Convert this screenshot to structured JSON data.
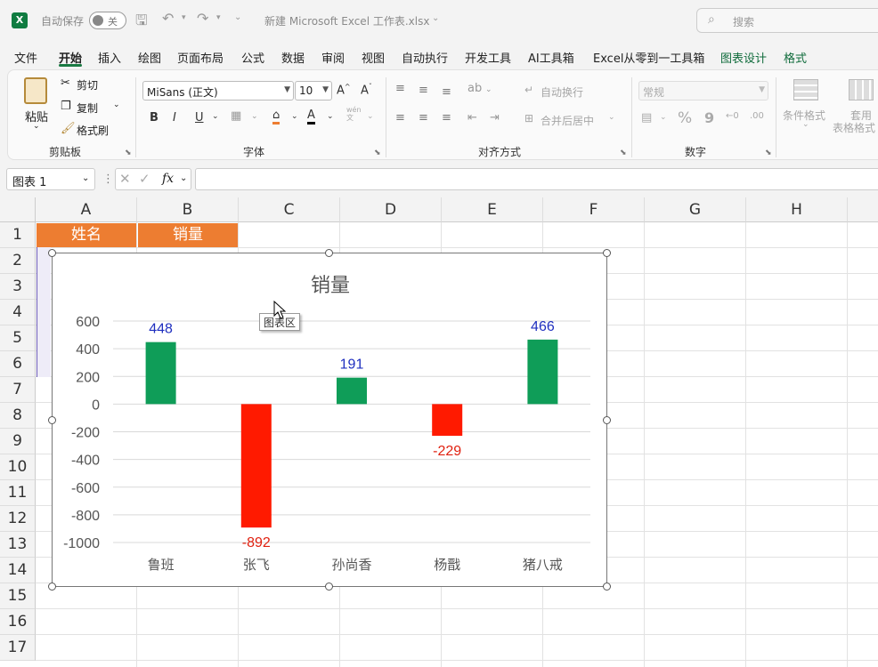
{
  "titlebar": {
    "autosave_label": "自动保存",
    "autosave_state": "关",
    "doc_title": "新建 Microsoft Excel 工作表.xlsx",
    "search_placeholder": "搜索"
  },
  "tabs": [
    "文件",
    "开始",
    "插入",
    "绘图",
    "页面布局",
    "公式",
    "数据",
    "审阅",
    "视图",
    "自动执行",
    "开发工具",
    "AI工具箱",
    "Excel从零到一工具箱",
    "图表设计",
    "格式"
  ],
  "active_tab": "开始",
  "ribbon": {
    "clipboard": {
      "paste": "粘贴",
      "cut": "剪切",
      "copy": "复制",
      "format_painter": "格式刷",
      "label": "剪贴板"
    },
    "font": {
      "name": "MiSans (正文)",
      "size": "10",
      "bold": "B",
      "italic": "I",
      "underline": "U",
      "label": "字体",
      "wen": "wén",
      "wen2": "文"
    },
    "alignment": {
      "wrap": "自动换行",
      "merge": "合并后居中",
      "label": "对齐方式"
    },
    "number": {
      "format": "常规",
      "percent": "%",
      "comma": "9",
      "label": "数字"
    },
    "styles": {
      "conditional": "条件格式",
      "table_format_1": "套用",
      "table_format_2": "表格格式"
    }
  },
  "formula_bar": {
    "name_box": "图表 1",
    "fx": "fx"
  },
  "grid": {
    "columns": [
      "A",
      "B",
      "C",
      "D",
      "E",
      "F",
      "G",
      "H"
    ],
    "rows": [
      "1",
      "2",
      "3",
      "4",
      "5",
      "6",
      "7",
      "8",
      "9",
      "10",
      "11",
      "12",
      "13",
      "14",
      "15",
      "16",
      "17"
    ],
    "header_cells": {
      "A1": "姓名",
      "B1": "销量"
    }
  },
  "tooltip": "图表区",
  "chart_data": {
    "type": "bar",
    "title": "销量",
    "categories": [
      "鲁班",
      "张飞",
      "孙尚香",
      "杨戬",
      "猪八戒"
    ],
    "values": [
      448,
      -892,
      191,
      -229,
      466
    ],
    "ylim": [
      -1000,
      600
    ],
    "yticks": [
      "600",
      "400",
      "200",
      "0",
      "-200",
      "-400",
      "-600",
      "-800",
      "-1000"
    ],
    "grid": true,
    "colors": {
      "positive": "#0f9d58",
      "negative": "#ff1a00",
      "positive_label": "#1f2fbf",
      "negative_label": "#e0200f",
      "gridline": "#d9d9d9"
    }
  },
  "colors": {
    "accent": "#1a7a43",
    "header_fill": "#ed7d31"
  }
}
